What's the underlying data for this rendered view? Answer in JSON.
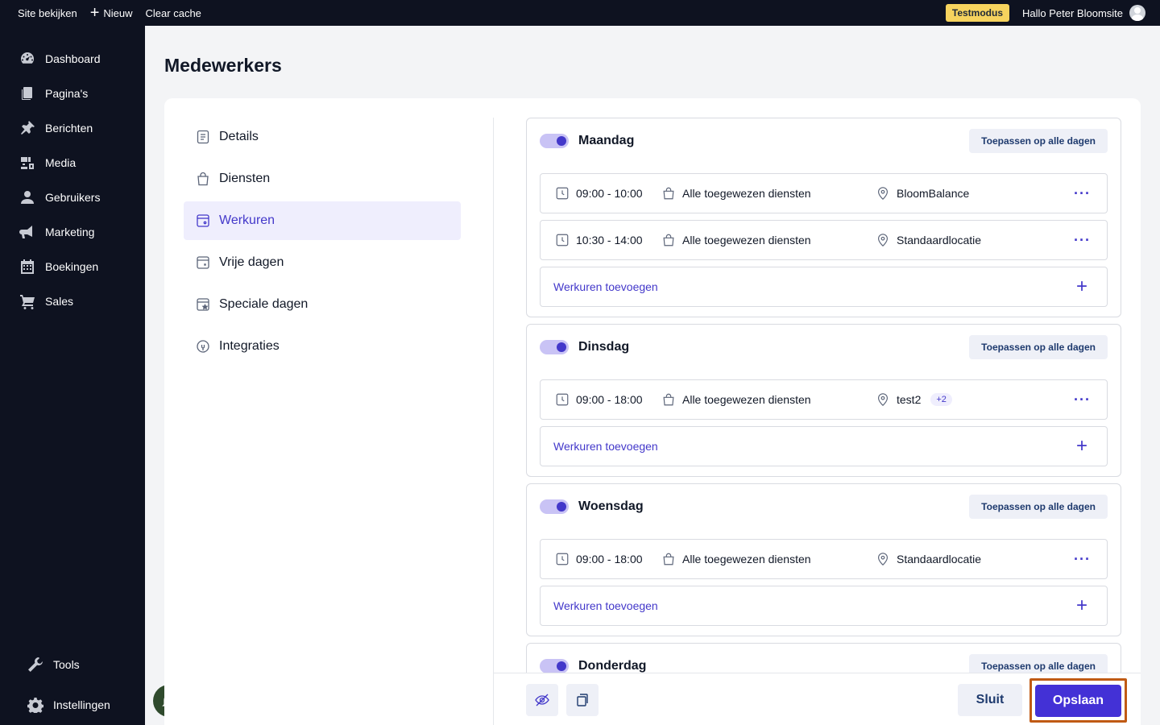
{
  "topbar": {
    "view_site": "Site bekijken",
    "new_label": "Nieuw",
    "clear_cache": "Clear cache",
    "test_mode": "Testmodus",
    "greeting": "Hallo Peter Bloomsite"
  },
  "sidebar": {
    "items": [
      {
        "label": "Dashboard",
        "icon": "dashboard-icon"
      },
      {
        "label": "Pagina's",
        "icon": "pages-icon"
      },
      {
        "label": "Berichten",
        "icon": "pin-icon"
      },
      {
        "label": "Media",
        "icon": "media-icon"
      },
      {
        "label": "Gebruikers",
        "icon": "user-icon"
      },
      {
        "label": "Marketing",
        "icon": "megaphone-icon"
      },
      {
        "label": "Boekingen",
        "icon": "calendar-icon"
      },
      {
        "label": "Sales",
        "icon": "cart-icon"
      }
    ],
    "bottom": [
      {
        "label": "Tools",
        "icon": "wrench-icon"
      },
      {
        "label": "Instellingen",
        "icon": "gear-icon"
      }
    ]
  },
  "page": {
    "title": "Medewerkers"
  },
  "subnav": {
    "items": [
      {
        "label": "Details",
        "active": false
      },
      {
        "label": "Diensten",
        "active": false
      },
      {
        "label": "Werkuren",
        "active": true
      },
      {
        "label": "Vrije dagen",
        "active": false
      },
      {
        "label": "Speciale dagen",
        "active": false
      },
      {
        "label": "Integraties",
        "active": false
      }
    ]
  },
  "days": [
    {
      "name": "Maandag",
      "enabled": true,
      "apply_label": "Toepassen op alle dagen",
      "slots": [
        {
          "time": "09:00 - 10:00",
          "services": "Alle toegewezen diensten",
          "location": "BloomBalance",
          "extra": ""
        },
        {
          "time": "10:30 - 14:00",
          "services": "Alle toegewezen diensten",
          "location": "Standaardlocatie",
          "extra": ""
        }
      ],
      "add_label": "Werkuren toevoegen"
    },
    {
      "name": "Dinsdag",
      "enabled": true,
      "apply_label": "Toepassen op alle dagen",
      "slots": [
        {
          "time": "09:00 - 18:00",
          "services": "Alle toegewezen diensten",
          "location": "test2",
          "extra": "+2"
        }
      ],
      "add_label": "Werkuren toevoegen"
    },
    {
      "name": "Woensdag",
      "enabled": true,
      "apply_label": "Toepassen op alle dagen",
      "slots": [
        {
          "time": "09:00 - 18:00",
          "services": "Alle toegewezen diensten",
          "location": "Standaardlocatie",
          "extra": ""
        }
      ],
      "add_label": "Werkuren toevoegen"
    },
    {
      "name": "Donderdag",
      "enabled": true,
      "apply_label": "Toepassen op alle dagen",
      "slots": [],
      "add_label": ""
    }
  ],
  "actions": {
    "close_label": "Sluit",
    "save_label": "Opslaan"
  },
  "colors": {
    "accent": "#4338ca",
    "primary_button": "#4331d6",
    "sidebar_bg": "#0e1220",
    "test_mode_badge": "#f6d35e",
    "highlight_outline": "#c05a14"
  }
}
